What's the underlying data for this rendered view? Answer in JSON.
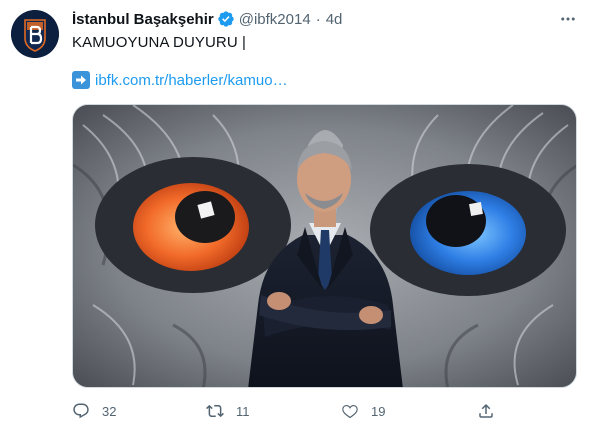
{
  "tweet": {
    "author": {
      "display_name": "İstanbul Başakşehir",
      "handle": "@ibfk2014",
      "verified": true,
      "avatar_icon": "club-crest-logo"
    },
    "separator": "·",
    "time": "4d",
    "text": "KAMUOYUNA DUYURU |",
    "link": {
      "icon": "right-arrow-emoji",
      "text": "ibfk.com.tr/haberler/kamuo…"
    },
    "media": {
      "icon": "photo-man-in-front-of-owl-mural"
    },
    "actions": {
      "replies": "32",
      "retweets": "11",
      "likes": "19"
    }
  },
  "colors": {
    "link": "#1d9bf0",
    "text": "#0f1419",
    "secondary": "#536471",
    "verified": "#1d9bf0",
    "arrow_box": "#3b94d9"
  }
}
